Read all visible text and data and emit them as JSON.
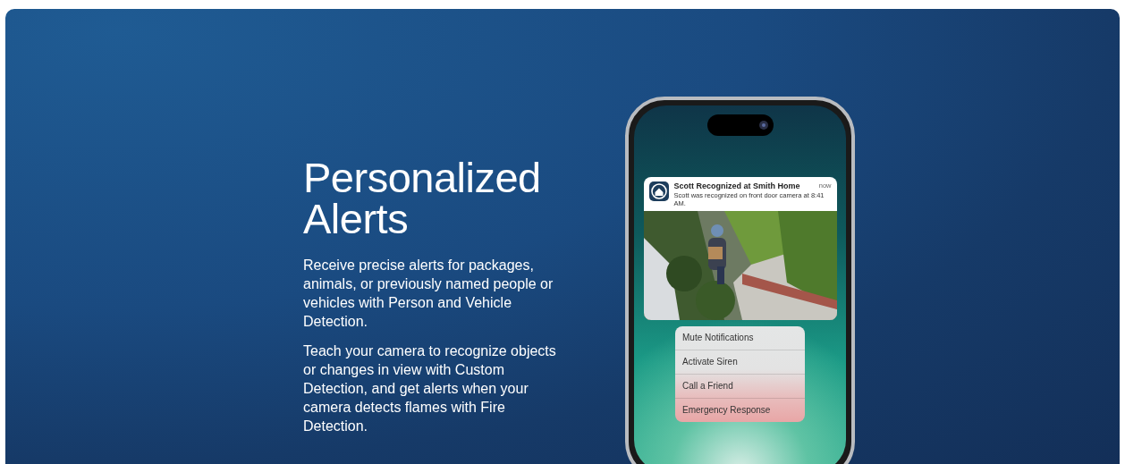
{
  "heading": "Personalized Alerts",
  "paragraphs": [
    "Receive precise alerts for packages, animals, or previously named people or vehicles with Person and Vehicle Detection.",
    "Teach your camera to recognize objects or changes in view with Custom Detection, and get alerts when your camera detects flames with Fire Detection."
  ],
  "notification": {
    "title": "Scott Recognized at Smith Home",
    "time": "now",
    "body": "Scott was recognized on front door camera at 8:41 AM."
  },
  "actions": [
    "Mute Notifications",
    "Activate Siren",
    "Call a Friend",
    "Emergency Response"
  ]
}
